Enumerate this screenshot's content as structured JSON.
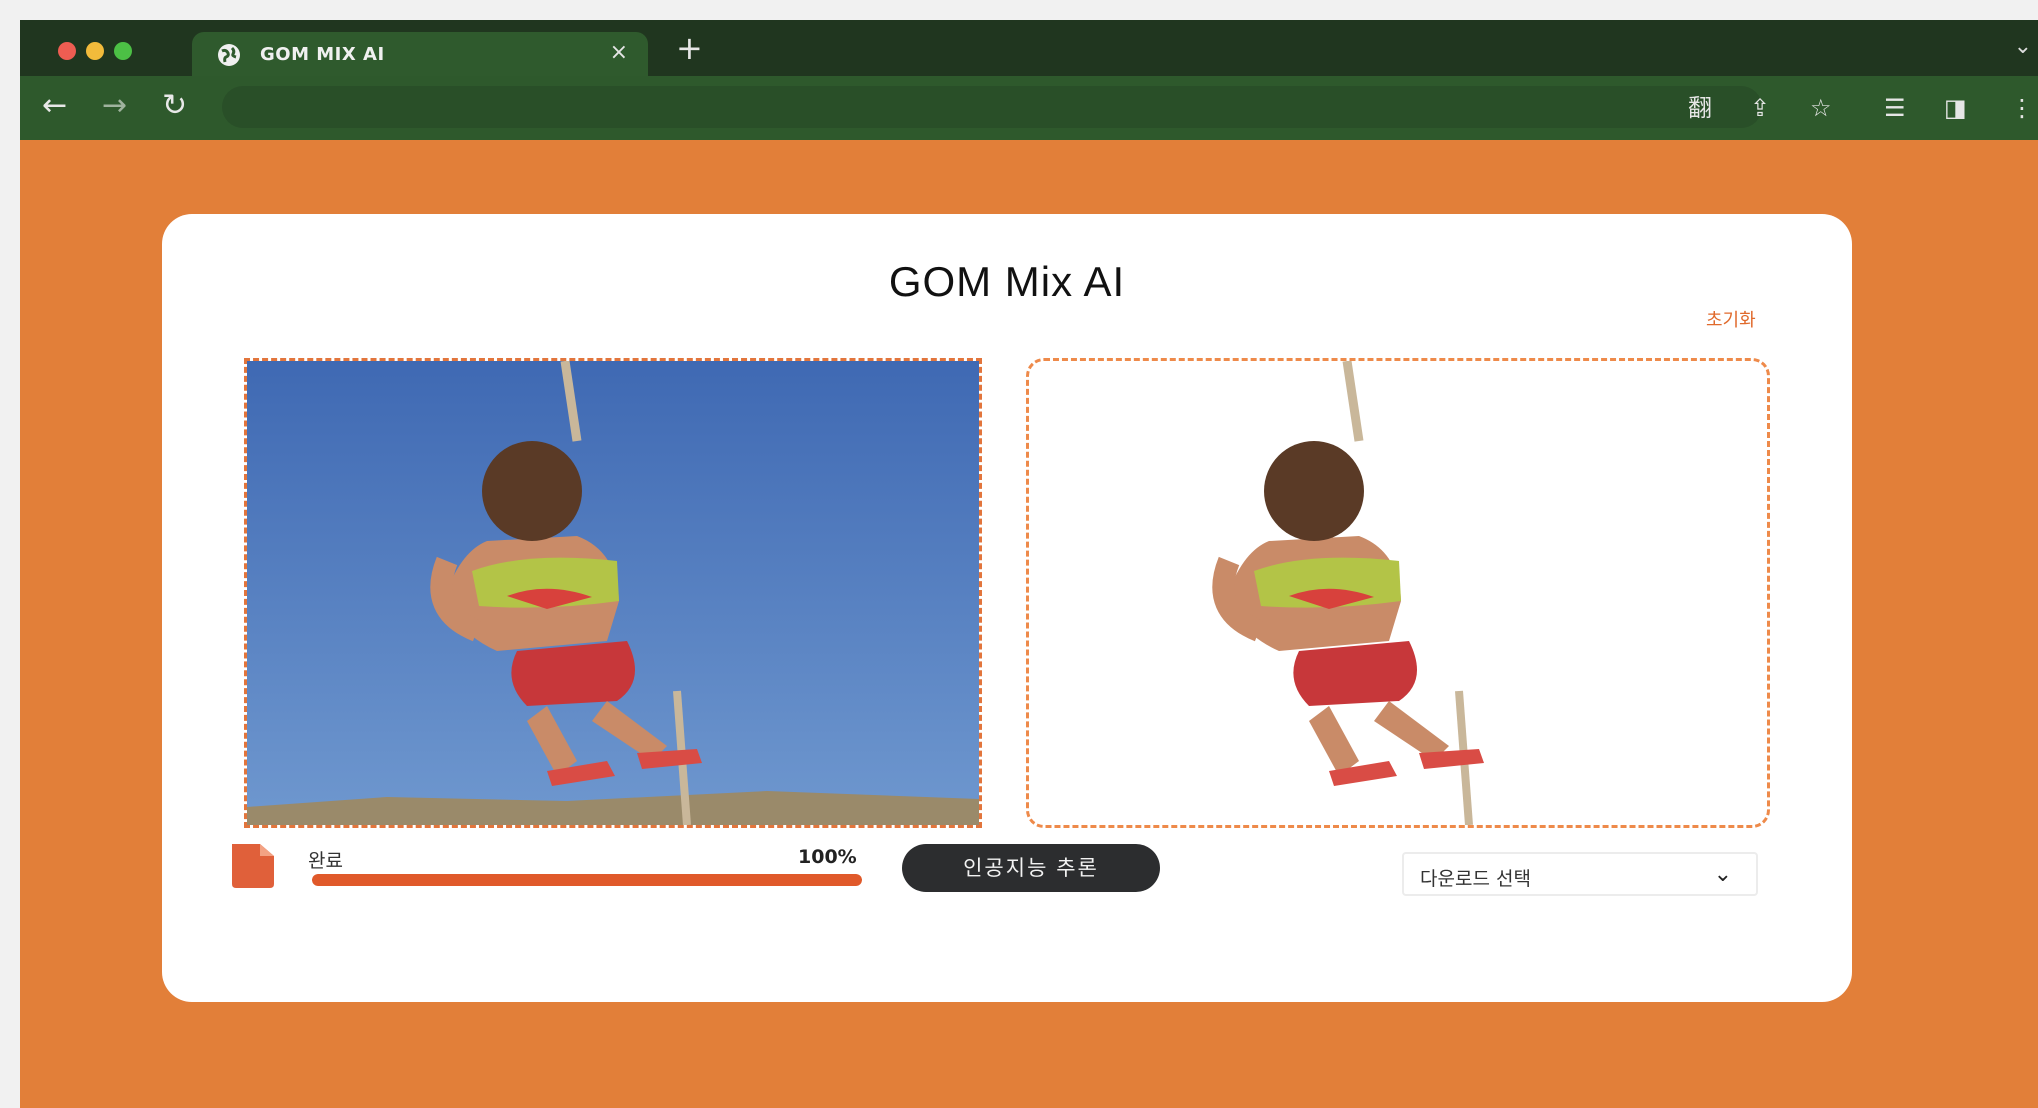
{
  "browser": {
    "tab_title": "GOM MIX AI",
    "tab_close": "×",
    "new_tab": "+",
    "tab_dropdown": "⌄",
    "nav": {
      "back": "←",
      "forward": "→",
      "reload": "↻"
    },
    "toolbar_icons": {
      "translate": "翻",
      "share": "⇪",
      "bookmark": "☆",
      "reading_list": "☰",
      "side_panel": "◨",
      "menu": "⋮"
    }
  },
  "app": {
    "title": "GOM Mix AI",
    "reset_label": "초기화",
    "status_label": "완료",
    "progress_text": "100%",
    "progress_value": 100,
    "infer_button": "인공지능 추론",
    "download_select": "다운로드 선택",
    "download_chevron": "⌄"
  },
  "colors": {
    "accent": "#e27f39",
    "progress": "#e0592a",
    "tab_bar": "#20361f",
    "toolbar": "#2e592c"
  },
  "icons": [
    "globe-icon",
    "file-icon",
    "chevron-down-icon"
  ]
}
